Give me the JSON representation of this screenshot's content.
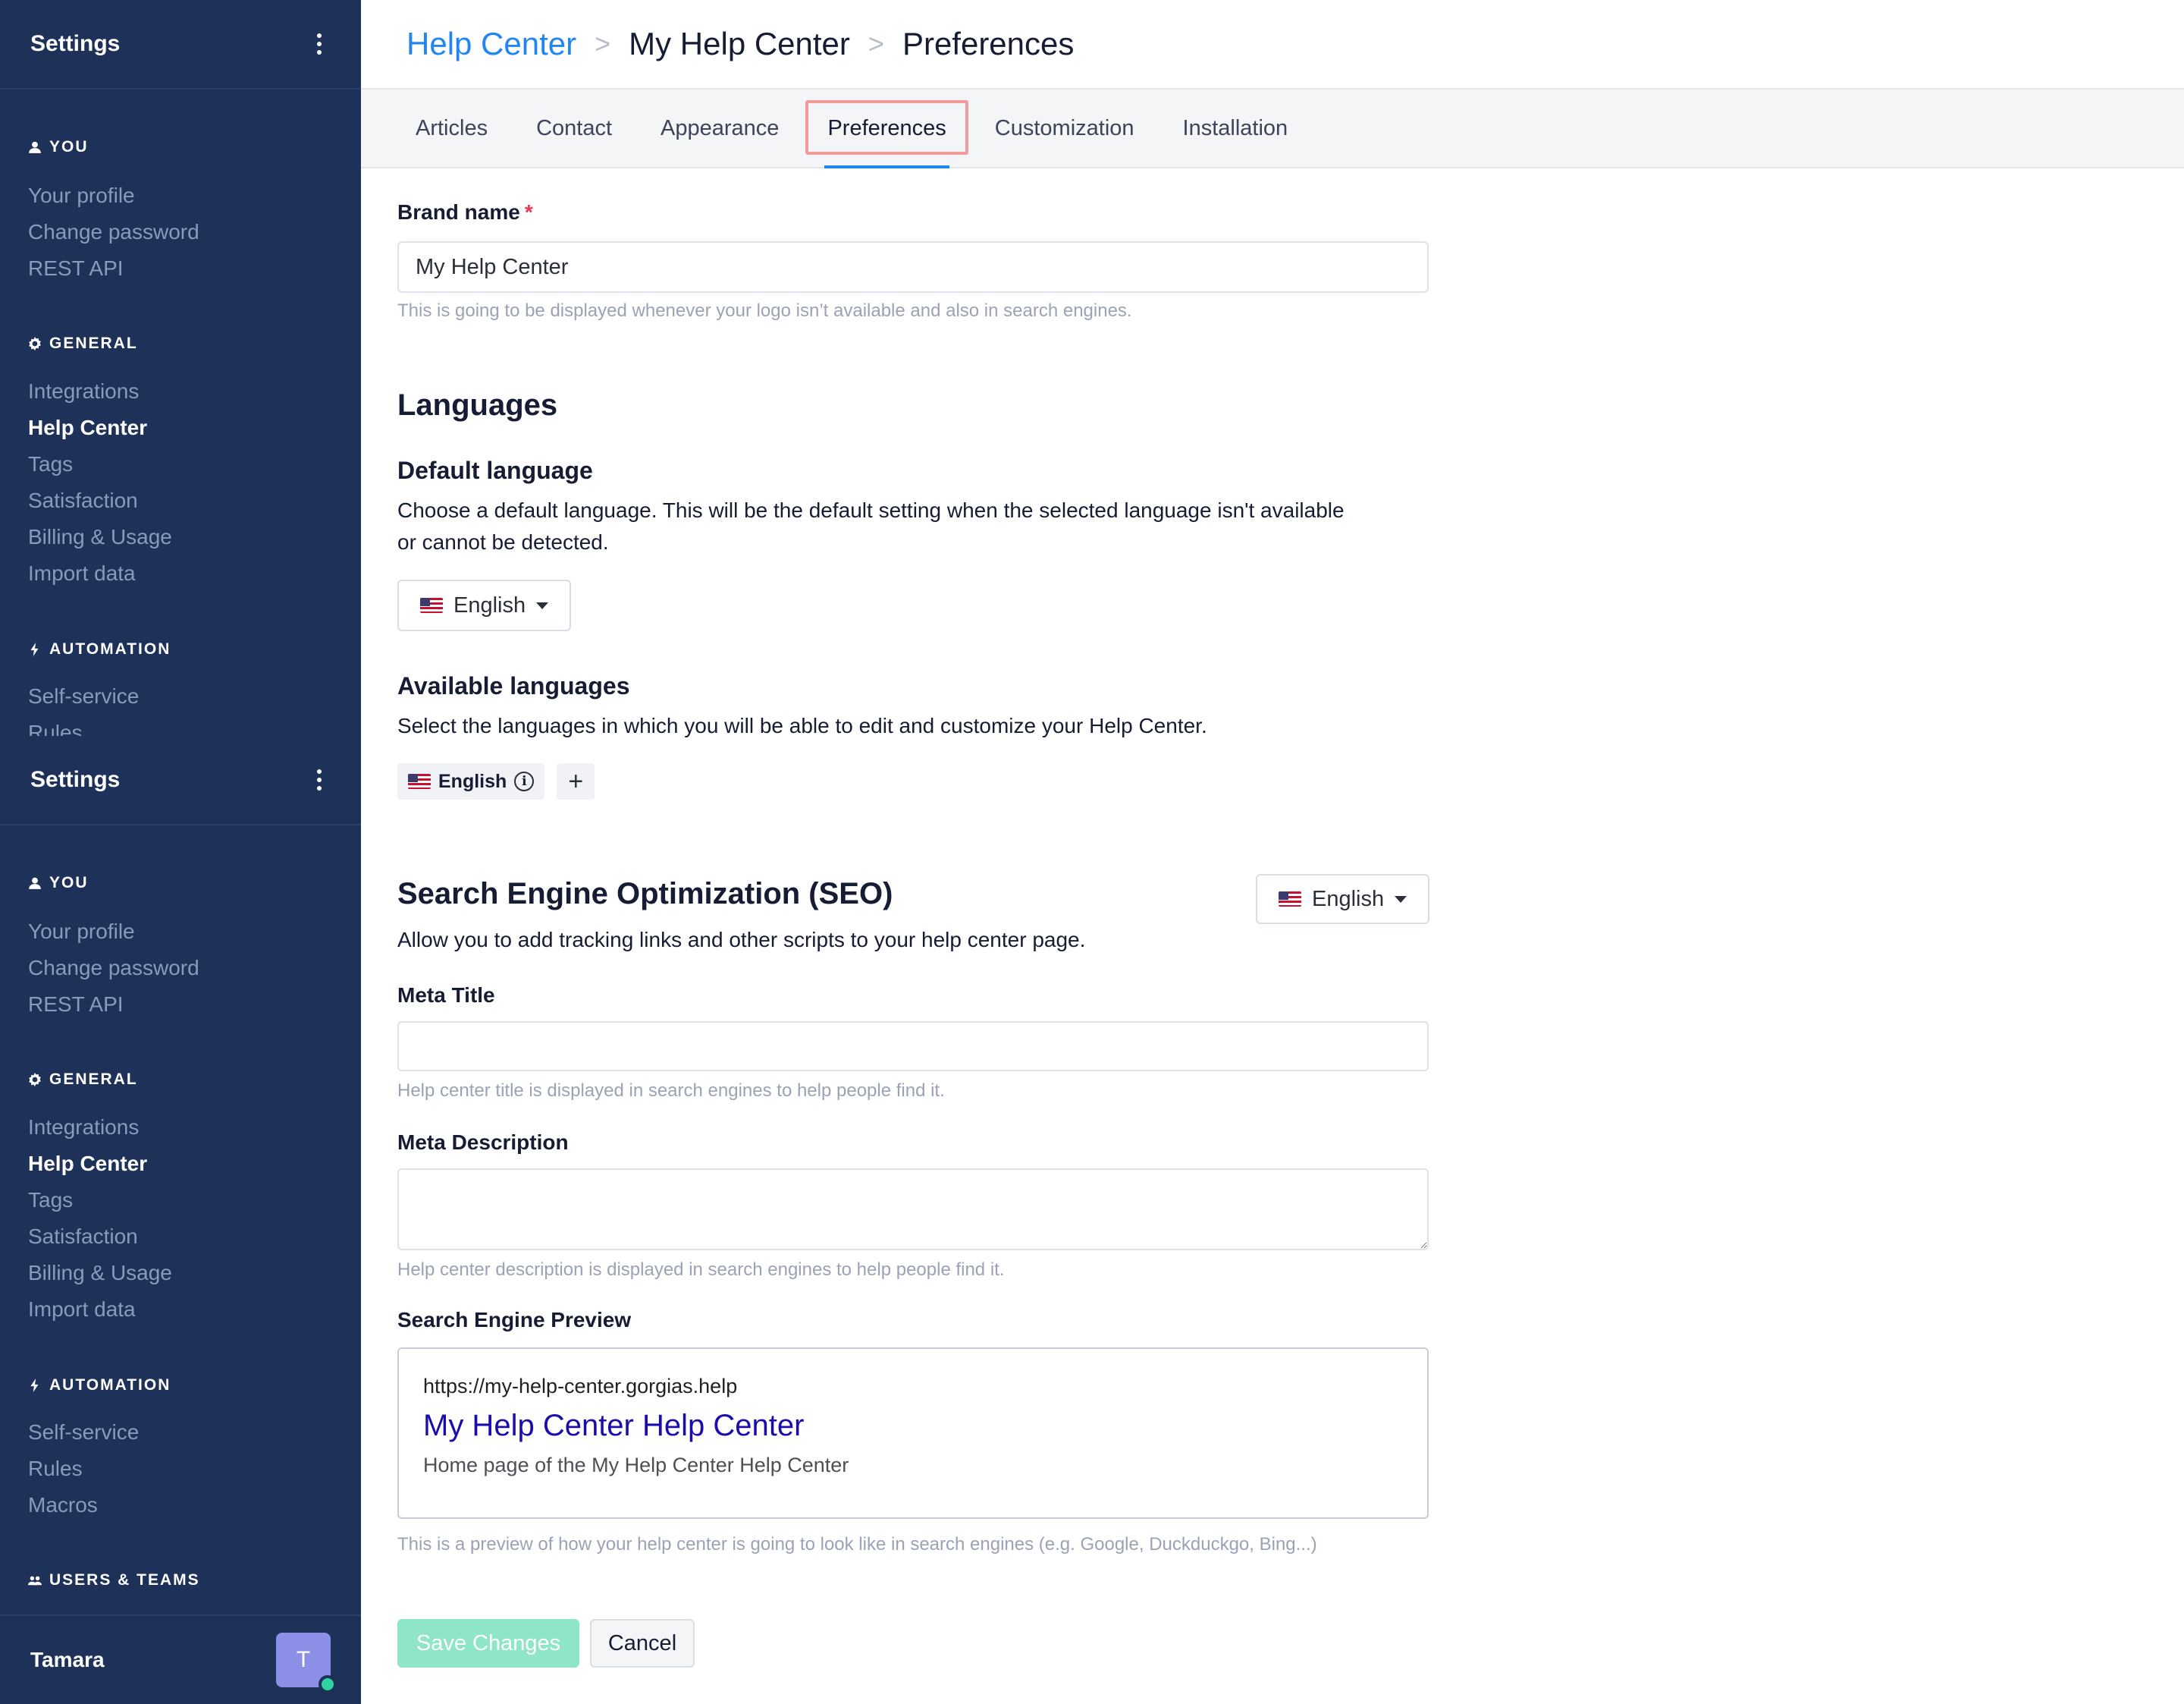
{
  "sidebar": {
    "title": "Settings",
    "sections": [
      {
        "heading": "YOU",
        "items": [
          "Your profile",
          "Change password",
          "REST API"
        ]
      },
      {
        "heading": "GENERAL",
        "items": [
          "Integrations",
          "Help Center",
          "Tags",
          "Satisfaction",
          "Billing & Usage",
          "Import data"
        ]
      },
      {
        "heading": "AUTOMATION",
        "items": [
          "Self-service",
          "Rules",
          "Macros"
        ]
      },
      {
        "heading": "USERS & TEAMS",
        "items": []
      }
    ],
    "active_item": "Help Center",
    "user": {
      "name": "Tamara",
      "initial": "T"
    }
  },
  "breadcrumb": {
    "root": "Help Center",
    "middle": "My Help Center",
    "current": "Preferences",
    "separator": ">"
  },
  "tabs": [
    "Articles",
    "Contact",
    "Appearance",
    "Preferences",
    "Customization",
    "Installation"
  ],
  "active_tab": "Preferences",
  "brand": {
    "label": "Brand name",
    "required_mark": "*",
    "value": "My Help Center",
    "help": "This is going to be displayed whenever your logo isn’t available and also in search engines."
  },
  "languages": {
    "heading": "Languages",
    "default_heading": "Default language",
    "default_desc_line1": "Choose a default language. This will be the default setting when the selected language isn't available",
    "default_desc_line2": "or cannot be detected.",
    "default_value": "English",
    "available_heading": "Available languages",
    "available_desc": "Select the languages in which you will be able to edit and customize your Help Center.",
    "available_chip": "English",
    "add_label": "+"
  },
  "seo": {
    "heading": "Search Engine Optimization (SEO)",
    "language": "English",
    "desc": "Allow you to add tracking links and other scripts to your help center page.",
    "meta_title_label": "Meta Title",
    "meta_title_value": "",
    "meta_title_help": "Help center title is displayed in search engines to help people find it.",
    "meta_desc_label": "Meta Description",
    "meta_desc_value": "",
    "meta_desc_help": "Help center description is displayed in search engines to help people find it.",
    "preview_label": "Search Engine Preview",
    "preview_url": "https://my-help-center.gorgias.help",
    "preview_title": "My Help Center Help Center",
    "preview_desc": "Home page of the My Help Center Help Center",
    "preview_help": "This is a preview of how your help center is going to look like in search engines (e.g. Google, Duckduckgo, Bing...)"
  },
  "actions": {
    "save": "Save Changes",
    "cancel": "Cancel"
  },
  "colors": {
    "sidebar_bg": "#1e3158",
    "link": "#2186f0",
    "save_disabled": "#8ee6c6",
    "tab_highlight": "#f39b9b"
  }
}
